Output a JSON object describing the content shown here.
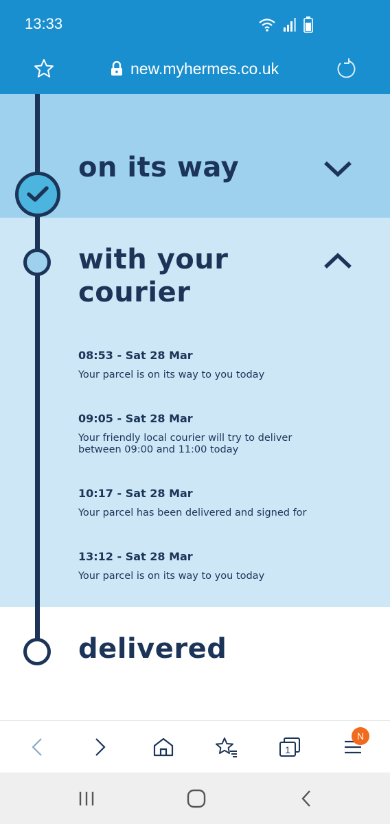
{
  "status_bar": {
    "time": "13:33",
    "icons": [
      "wifi-icon",
      "signal-icon",
      "battery-icon"
    ]
  },
  "browser": {
    "url": "new.myhermes.co.uk",
    "icons": [
      "star-icon",
      "lock-icon",
      "reload-icon"
    ]
  },
  "timeline": {
    "stages": [
      {
        "title": "on its way",
        "state": "complete",
        "expanded": false
      },
      {
        "title_line1": "with your",
        "title_line2": "courier",
        "state": "current",
        "expanded": true
      },
      {
        "title": "delivered",
        "state": "pending"
      }
    ],
    "events": [
      {
        "time": "08:53 - Sat 28 Mar",
        "description": "Your parcel is on its way to you today"
      },
      {
        "time": "09:05 - Sat 28 Mar",
        "description_line1": "Your friendly local courier will try to deliver",
        "description_line2": "between 09:00 and 11:00 today"
      },
      {
        "time": "10:17 - Sat 28 Mar",
        "description": "Your parcel has been delivered and signed for"
      },
      {
        "time": "13:12 - Sat 28 Mar",
        "description": "Your parcel is on its way to you today"
      }
    ]
  },
  "bottom_nav": {
    "tabs_count": "1",
    "menu_badge": "N",
    "icons": [
      "back-icon",
      "forward-icon",
      "home-icon",
      "bookmarks-icon",
      "tabs-icon",
      "menu-icon"
    ]
  },
  "colors": {
    "header_blue": "#1a8fcf",
    "section_complete": "#9dd1ed",
    "section_current": "#cde7f6",
    "navy": "#1c3458",
    "badge_orange": "#f26a1b"
  }
}
